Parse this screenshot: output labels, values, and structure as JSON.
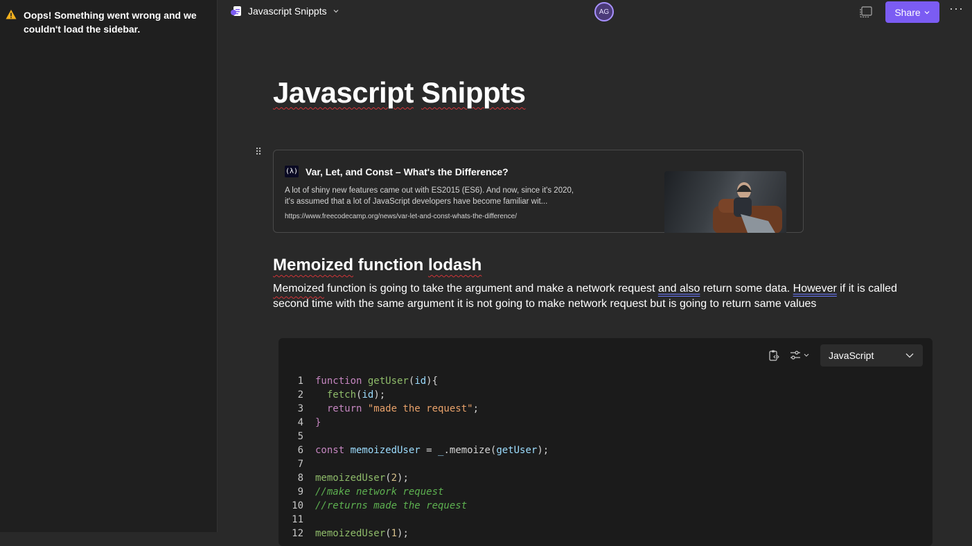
{
  "sidebar": {
    "error_message": "Oops! Something went wrong and we couldn't load the sidebar."
  },
  "topbar": {
    "doc_title": "Javascript Snippts",
    "avatar_initials": "AG",
    "share_label": "Share",
    "more_label": "···"
  },
  "page": {
    "title_word1": "Javascript",
    "title_word2": "Snippts"
  },
  "link_card": {
    "logo": "(λ)",
    "title": "Var, Let, and Const – What's the Difference?",
    "description": "A lot of shiny new features came out with ES2015 (ES6). And now, since it's 2020, it's assumed that a lot of JavaScript developers have become familiar wit...",
    "url": "https://www.freecodecamp.org/news/var-let-and-const-whats-the-difference/"
  },
  "section": {
    "heading_word1": "Memoized",
    "heading_word2": "function",
    "heading_word3": "lodash",
    "para_w1": "Memoized",
    "para_w2": " function is going to take the argument and make a network request ",
    "para_w3": "and also",
    "para_w4": " return some data. ",
    "para_w5": "However",
    "para_w6": " if it is called second time with the same argument it is not going to make network request but is going to return same values"
  },
  "code_block": {
    "language": "JavaScript",
    "line_numbers": [
      "1",
      "2",
      "3",
      "4",
      "5",
      "6",
      "7",
      "8",
      "9",
      "10",
      "11",
      "12"
    ],
    "line1": {
      "kw": "function ",
      "fn": "getUser",
      "p1": "(",
      "v": "id",
      "p2": "){"
    },
    "line2": {
      "fn": "  fetch",
      "p1": "(",
      "v": "id",
      "p2": ");"
    },
    "line3": {
      "kw": "  return ",
      "str": "\"made the request\"",
      "p": ";"
    },
    "line4": {
      "p": "}"
    },
    "line6": {
      "kw": "const ",
      "v": "memoizedUser",
      "p1": " = ",
      "u": "_",
      "p2": ".memoize(",
      "v2": "getUser",
      "p3": ");"
    },
    "line8": {
      "fn": "memoizedUser",
      "p1": "(",
      "n": "2",
      "p2": ");"
    },
    "line9": {
      "cm": "//make network request"
    },
    "line10": {
      "cm": "//returns made the request"
    },
    "line12": {
      "fn": "memoizedUser",
      "p1": "(",
      "n": "1",
      "p2": ");"
    }
  }
}
